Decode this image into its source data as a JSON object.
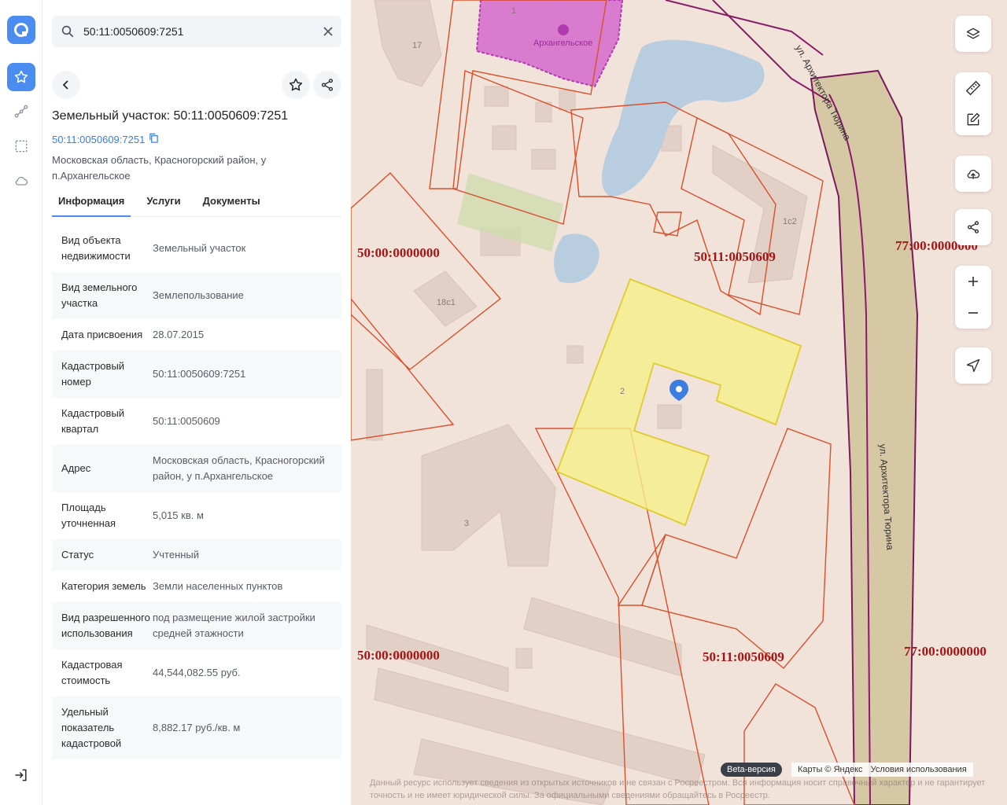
{
  "search": {
    "value": "50:11:0050609:7251",
    "placeholder": ""
  },
  "object": {
    "title": "Земельный участок: 50:11:0050609:7251",
    "cad_link": "50:11:0050609:7251",
    "address": "Московская область, Красногорский район, у п.Архангельское"
  },
  "tabs": [
    "Информация",
    "Услуги",
    "Документы"
  ],
  "props": [
    {
      "k": "Вид объекта недвижимости",
      "v": "Земельный участок"
    },
    {
      "k": "Вид земельного участка",
      "v": "Землепользование"
    },
    {
      "k": "Дата присвоения",
      "v": "28.07.2015"
    },
    {
      "k": "Кадастровый номер",
      "v": "50:11:0050609:7251"
    },
    {
      "k": "Кадастровый квартал",
      "v": "50:11:0050609"
    },
    {
      "k": "Адрес",
      "v": "Московская область, Красногорский район, у п.Архангельское"
    },
    {
      "k": "Площадь уточненная",
      "v": "5,015 кв. м"
    },
    {
      "k": "Статус",
      "v": "Учтенный"
    },
    {
      "k": "Категория земель",
      "v": "Земли населенных пунктов"
    },
    {
      "k": "Вид разрешенного использования",
      "v": "под размещение жилой застройки средней этажности"
    },
    {
      "k": "Кадастровая стоимость",
      "v": "44,544,082.55 руб."
    },
    {
      "k": "Удельный показатель кадастровой",
      "v": "8,882.17 руб./кв. м"
    }
  ],
  "map": {
    "labels": {
      "q1": "50:00:0000000",
      "q2": "50:11:0050609",
      "q3": "77:00:0000000",
      "q4": "50:00:0000000",
      "q5": "50:11:0050609",
      "q6": "77:00:0000000",
      "poi": "Архангельское",
      "street1": "ул. Архитектора Тюрина",
      "street2": "ул. Архитектора Тюрина",
      "b1": "1",
      "b17": "17",
      "b1c2": "1с2",
      "b18c1": "18с1",
      "b2": "2",
      "b3": "3"
    },
    "beta": "Beta-версия",
    "yandex": "Карты © Яндекс",
    "terms": "Условия использования",
    "disclaimer": "Данный ресурс использует сведения из открытых источников и не связан с Росреестром. Вся информация носит справочный характер и не гарантирует точность и не имеет юридической силы. За официальными сведениями обращайтесь в Росреестр."
  },
  "colors": {
    "accent": "#4a8cf0",
    "parcel_border": "#d9502a",
    "selected_fill": "#f7f08a",
    "quarter_label": "#a31515"
  }
}
